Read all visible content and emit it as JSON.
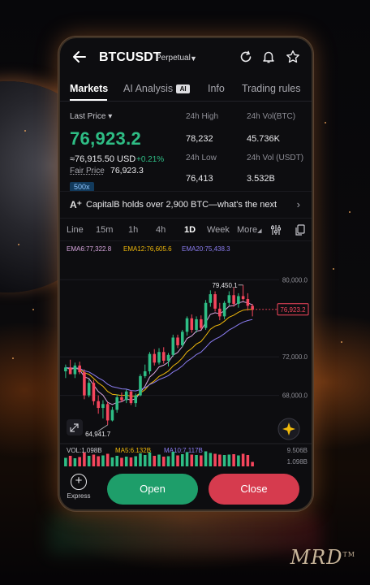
{
  "header": {
    "symbol": "BTCUSDT",
    "contract_type": "Perpetual"
  },
  "tabs": [
    {
      "label": "Markets",
      "active": true
    },
    {
      "label": "AI Analysis",
      "badge": "AI"
    },
    {
      "label": "Info"
    },
    {
      "label": "Trading rules"
    }
  ],
  "ticker": {
    "last_price_label": "Last Price",
    "last_price": "76,923.2",
    "usd_price": "≈76,915.50 USD",
    "change": "+0.21%",
    "fair_price_label": "Fair Price",
    "fair_price": "76,923.3",
    "leverage": "500x",
    "high_label": "24h High",
    "high": "78,232",
    "low_label": "24h Low",
    "low": "76,413",
    "vol_btc_label": "24h Vol(BTC)",
    "vol_btc": "45.736K",
    "vol_usdt_label": "24h Vol (USDT)",
    "vol_usdt": "3.532B"
  },
  "news": {
    "text": "CapitalB holds over 2,900 BTC—what's the next"
  },
  "timeframes": [
    {
      "label": "Line"
    },
    {
      "label": "15m"
    },
    {
      "label": "1h"
    },
    {
      "label": "4h"
    },
    {
      "label": "1D",
      "active": true
    },
    {
      "label": "Week"
    },
    {
      "label": "More"
    }
  ],
  "indicators": {
    "ema6": "EMA6:77,322.8",
    "ema12": "EMA12:76,605.6",
    "ema20": "EMA20:75,438.3",
    "vol": "VOL:1.098B",
    "ma5": "MA5:6.132B",
    "ma10": "MA10:7.117B"
  },
  "colors": {
    "up": "#2ebd85",
    "down": "#f6465d",
    "ema6": "#d9a7e0",
    "ema12": "#f0b90b",
    "ema20": "#8a7cf0",
    "accent_open": "#1e9e6a",
    "accent_close": "#d63b4e"
  },
  "chart_data": {
    "type": "candlestick",
    "y_axis_labels": [
      "80,000.0",
      "72,000.0",
      "68,000.0"
    ],
    "y_ticks": [
      80000,
      72000,
      68000
    ],
    "ylim": [
      63500,
      80700
    ],
    "current_price": 76923.2,
    "current_price_label": "76,923.2",
    "max_label": "79,450.1",
    "max_value": 79450.1,
    "min_label": "64,941.7",
    "min_value": 64941.7,
    "ohlc": [
      [
        70500,
        71200,
        69800,
        70900
      ],
      [
        70900,
        71700,
        70400,
        70200
      ],
      [
        70200,
        71400,
        69800,
        71100
      ],
      [
        71100,
        71500,
        70200,
        70400
      ],
      [
        70400,
        70700,
        67600,
        68000
      ],
      [
        68000,
        69700,
        67800,
        69300
      ],
      [
        69300,
        69600,
        67000,
        67400
      ],
      [
        67400,
        68000,
        66100,
        66700
      ],
      [
        66700,
        67500,
        65600,
        67100
      ],
      [
        67100,
        67300,
        64942,
        65400
      ],
      [
        65400,
        66800,
        65300,
        66500
      ],
      [
        66500,
        68100,
        66200,
        67800
      ],
      [
        67800,
        68300,
        67300,
        67500
      ],
      [
        67500,
        68600,
        67200,
        68400
      ],
      [
        68400,
        68500,
        67000,
        67200
      ],
      [
        67200,
        68200,
        66800,
        68000
      ],
      [
        68000,
        70200,
        67900,
        70000
      ],
      [
        70000,
        71200,
        69800,
        70500
      ],
      [
        70500,
        72500,
        70200,
        72300
      ],
      [
        72300,
        72800,
        71100,
        71400
      ],
      [
        71400,
        72900,
        71200,
        72500
      ],
      [
        72500,
        73000,
        71300,
        71600
      ],
      [
        71600,
        72400,
        71000,
        72200
      ],
      [
        72200,
        74300,
        72000,
        74000
      ],
      [
        74000,
        74300,
        72900,
        73200
      ],
      [
        73200,
        74800,
        73000,
        74600
      ],
      [
        74600,
        76200,
        74200,
        76000
      ],
      [
        76000,
        76400,
        74500,
        74800
      ],
      [
        74800,
        76200,
        74500,
        75900
      ],
      [
        75900,
        76300,
        74800,
        75000
      ],
      [
        75000,
        77900,
        74800,
        77600
      ],
      [
        77600,
        78900,
        77200,
        78500
      ],
      [
        78500,
        78800,
        76700,
        77000
      ],
      [
        77000,
        77600,
        75800,
        76200
      ],
      [
        76200,
        77800,
        75900,
        77600
      ],
      [
        77600,
        78800,
        77300,
        78400
      ],
      [
        78400,
        79200,
        77200,
        77500
      ],
      [
        77500,
        78600,
        77100,
        78300
      ],
      [
        78300,
        79450,
        77800,
        78000
      ],
      [
        78000,
        78600,
        76800,
        77300
      ],
      [
        77300,
        77500,
        76200,
        76923
      ]
    ],
    "volume_axis_labels": [
      "9.506B",
      "1.098B"
    ],
    "volume_values": [
      2.1,
      2.6,
      2.0,
      2.3,
      3.4,
      2.6,
      2.9,
      2.5,
      2.7,
      3.1,
      2.2,
      2.6,
      2.1,
      2.4,
      2.2,
      2.5,
      3.2,
      2.8,
      3.4,
      2.6,
      2.9,
      2.4,
      2.5,
      3.6,
      2.7,
      3.0,
      3.5,
      2.9,
      2.8,
      2.7,
      3.7,
      3.3,
      3.1,
      2.9,
      2.8,
      2.9,
      3.0,
      2.7,
      3.1,
      2.8,
      1.1
    ]
  },
  "actions": {
    "express_label": "Express",
    "open_label": "Open",
    "close_label": "Close"
  },
  "watermark": "MRD"
}
